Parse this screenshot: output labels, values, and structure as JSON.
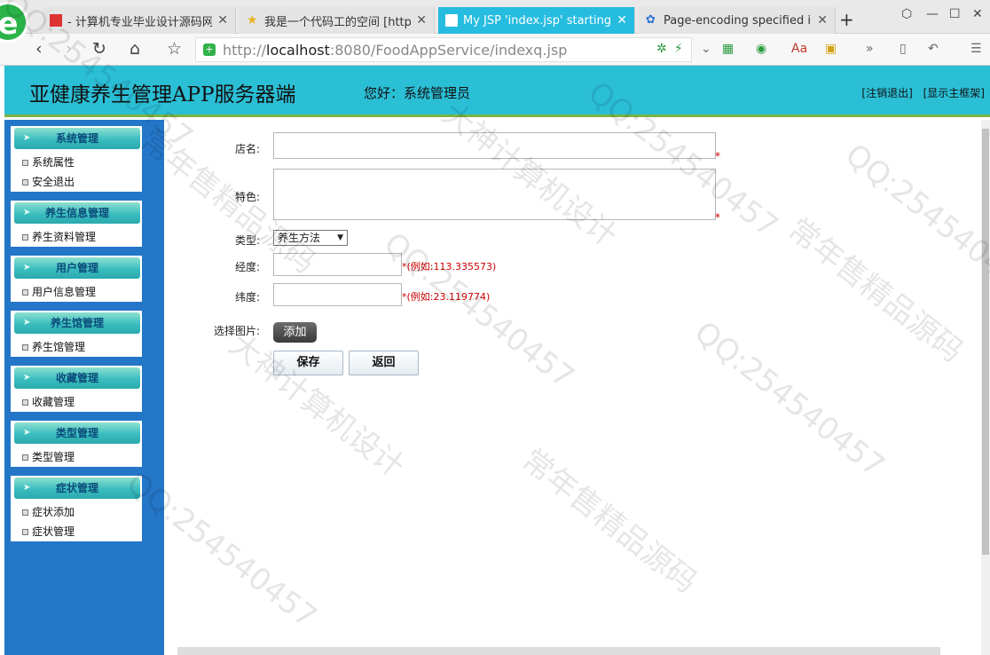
{
  "browser": {
    "tabs": [
      {
        "title": "- 计算机专业毕业设计源码网",
        "icon": "red-square-icon",
        "active": false
      },
      {
        "title": "我是一个代码工的空间 [http:/",
        "icon": "star-icon",
        "active": false
      },
      {
        "title": "My JSP 'index.jsp' starting p",
        "icon": "page-icon",
        "active": true
      },
      {
        "title": "Page-encoding specified in",
        "icon": "paw-icon",
        "active": false
      }
    ],
    "url_protocol": "http://",
    "url_host": "localhost",
    "url_path": ":8080/FoodAppService/indexq.jsp"
  },
  "header": {
    "title": "亚健康养生管理APP服务器端",
    "greeting": "您好：系统管理员",
    "logout": "[注销退出]",
    "show_frame": "[显示主框架]"
  },
  "sidebar": {
    "groups": [
      {
        "title": "系统管理",
        "items": [
          "系统属性",
          "安全退出"
        ]
      },
      {
        "title": "养生信息管理",
        "items": [
          "养生资料管理"
        ]
      },
      {
        "title": "用户管理",
        "items": [
          "用户信息管理"
        ]
      },
      {
        "title": "养生馆管理",
        "items": [
          "养生馆管理"
        ]
      },
      {
        "title": "收藏管理",
        "items": [
          "收藏管理"
        ]
      },
      {
        "title": "类型管理",
        "items": [
          "类型管理"
        ]
      },
      {
        "title": "症状管理",
        "items": [
          "症状添加",
          "症状管理"
        ]
      }
    ]
  },
  "form": {
    "name_label": "店名:",
    "feature_label": "特色:",
    "type_label": "类型:",
    "type_value": "养生方法",
    "longitude_label": "经度:",
    "longitude_hint": "*(例如:113.335573)",
    "latitude_label": "纬度:",
    "latitude_hint": "*(例如:23.119774)",
    "image_label": "选择图片:",
    "add_button": "添加",
    "save_button": "保存",
    "back_button": "返回",
    "required_mark": "*"
  },
  "watermarks": [
    "QQ:254540457",
    "大神计算机设计",
    "常年售精品源码"
  ],
  "colors": {
    "header": "#2bbfd6",
    "sidebar": "#2476c8",
    "active_tab": "#25bce0"
  }
}
